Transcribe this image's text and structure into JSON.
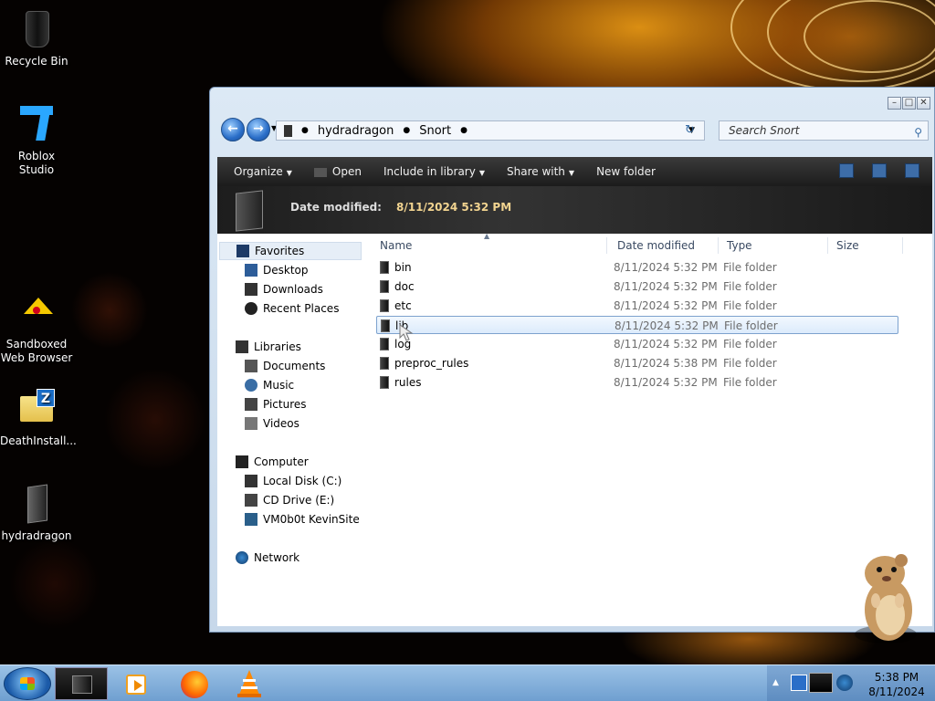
{
  "desktop": {
    "icons": [
      {
        "label": "Recycle Bin"
      },
      {
        "label": "Roblox Studio"
      },
      {
        "label": "Sandboxed Web Browser"
      },
      {
        "label": "DeathInstall..."
      },
      {
        "label": "hydradragon"
      }
    ]
  },
  "window": {
    "breadcrumb": [
      "hydradragon",
      "Snort"
    ],
    "search_placeholder": "Search Snort",
    "toolbar": {
      "organize": "Organize",
      "open": "Open",
      "include_in_library": "Include in library",
      "share_with": "Share with",
      "new_folder": "New folder"
    },
    "details": {
      "label": "Date modified:",
      "value": "8/11/2024 5:32 PM"
    },
    "nav": {
      "favorites": "Favorites",
      "desktop": "Desktop",
      "downloads": "Downloads",
      "recent_places": "Recent Places",
      "libraries": "Libraries",
      "documents": "Documents",
      "music": "Music",
      "pictures": "Pictures",
      "videos": "Videos",
      "computer": "Computer",
      "local_disk": "Local Disk (C:)",
      "cd_drive": "CD Drive (E:)",
      "vm": "VM0b0t KevinSite",
      "network": "Network"
    },
    "columns": {
      "name": "Name",
      "date_modified": "Date modified",
      "type": "Type",
      "size": "Size"
    },
    "files": [
      {
        "name": "bin",
        "date": "8/11/2024 5:32 PM",
        "type": "File folder"
      },
      {
        "name": "doc",
        "date": "8/11/2024 5:32 PM",
        "type": "File folder"
      },
      {
        "name": "etc",
        "date": "8/11/2024 5:32 PM",
        "type": "File folder"
      },
      {
        "name": "lib",
        "date": "8/11/2024 5:32 PM",
        "type": "File folder"
      },
      {
        "name": "log",
        "date": "8/11/2024 5:32 PM",
        "type": "File folder"
      },
      {
        "name": "preproc_rules",
        "date": "8/11/2024 5:38 PM",
        "type": "File folder"
      },
      {
        "name": "rules",
        "date": "8/11/2024 5:32 PM",
        "type": "File folder"
      }
    ],
    "selected_file": "lib"
  },
  "taskbar": {
    "time": "5:38 PM",
    "date": "8/11/2024"
  },
  "colors": {
    "accent": "#2a6ec8",
    "taskbar": "#8ab4df",
    "details_value": "#f2d490"
  }
}
